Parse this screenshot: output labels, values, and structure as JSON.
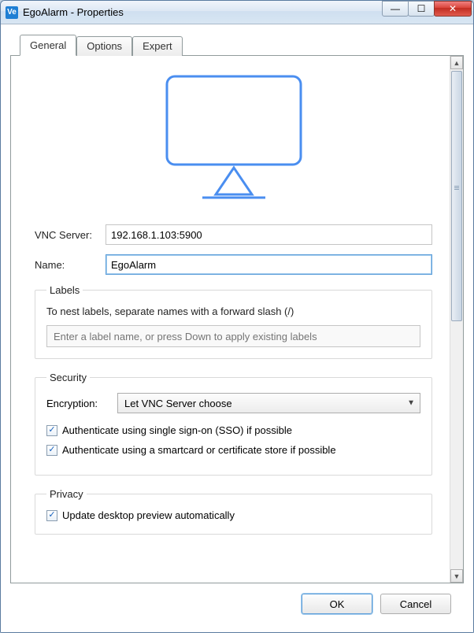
{
  "window": {
    "title": "EgoAlarm - Properties",
    "app_icon_text": "Ve"
  },
  "tabs": {
    "general": "General",
    "options": "Options",
    "expert": "Expert"
  },
  "general": {
    "vnc_server_label": "VNC Server:",
    "vnc_server_value": "192.168.1.103:5900",
    "name_label": "Name:",
    "name_value": "EgoAlarm"
  },
  "labels_group": {
    "legend": "Labels",
    "hint": "To nest labels, separate names with a forward slash (/)",
    "input_placeholder": "Enter a label name, or press Down to apply existing labels"
  },
  "security_group": {
    "legend": "Security",
    "encryption_label": "Encryption:",
    "encryption_value": "Let VNC Server choose",
    "sso_label": "Authenticate using single sign-on (SSO) if possible",
    "smartcard_label": "Authenticate using a smartcard or certificate store if possible",
    "sso_checked": true,
    "smartcard_checked": true
  },
  "privacy_group": {
    "legend": "Privacy",
    "update_preview_label": "Update desktop preview automatically",
    "update_preview_checked": true
  },
  "footer": {
    "ok": "OK",
    "cancel": "Cancel"
  },
  "icons": {
    "minimize": "—",
    "maximize": "☐",
    "close": "✕",
    "check": "✓",
    "chevron_down": "▼",
    "up_arrow": "▲",
    "down_arrow": "▼"
  },
  "colors": {
    "accent": "#4a8ef0",
    "link_blue": "#1560bd"
  }
}
